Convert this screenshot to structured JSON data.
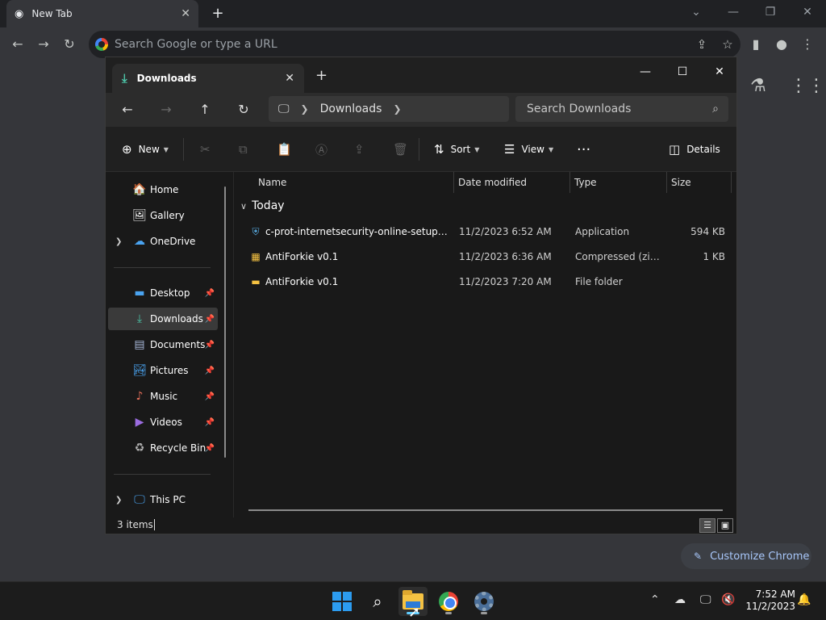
{
  "chrome": {
    "tab_title": "New Tab",
    "omnibox_placeholder": "Search Google or type a URL",
    "customize_label": "Customize Chrome"
  },
  "explorer": {
    "tab_title": "Downloads",
    "address": {
      "location": "Downloads"
    },
    "search_placeholder": "Search Downloads",
    "commands": {
      "new": "New",
      "sort": "Sort",
      "view": "View",
      "details": "Details"
    },
    "sidebar": {
      "home": "Home",
      "gallery": "Gallery",
      "onedrive": "OneDrive",
      "desktop": "Desktop",
      "downloads": "Downloads",
      "documents": "Documents",
      "pictures": "Pictures",
      "music": "Music",
      "videos": "Videos",
      "recycle_bin": "Recycle Bin",
      "this_pc": "This PC"
    },
    "columns": {
      "name": "Name",
      "date": "Date modified",
      "type": "Type",
      "size": "Size"
    },
    "group_label": "Today",
    "files": [
      {
        "name": "c-prot-internetsecurity-online-setup-x64...",
        "date": "11/2/2023 6:52 AM",
        "type": "Application",
        "size": "594 KB",
        "icon": "shield-app-icon"
      },
      {
        "name": "AntiForkie v0.1",
        "date": "11/2/2023 6:36 AM",
        "type": "Compressed (zipp...",
        "size": "1 KB",
        "icon": "zip-folder-icon"
      },
      {
        "name": "AntiForkie v0.1",
        "date": "11/2/2023 7:20 AM",
        "type": "File folder",
        "size": "",
        "icon": "folder-icon"
      }
    ],
    "status": {
      "count": "3 items"
    }
  },
  "taskbar": {
    "time": "7:52 AM",
    "date": "11/2/2023"
  },
  "colors": {
    "accent": "#60cdff",
    "downloads_green": "#4cc2a6",
    "folder_yellow": "#f5c242"
  }
}
